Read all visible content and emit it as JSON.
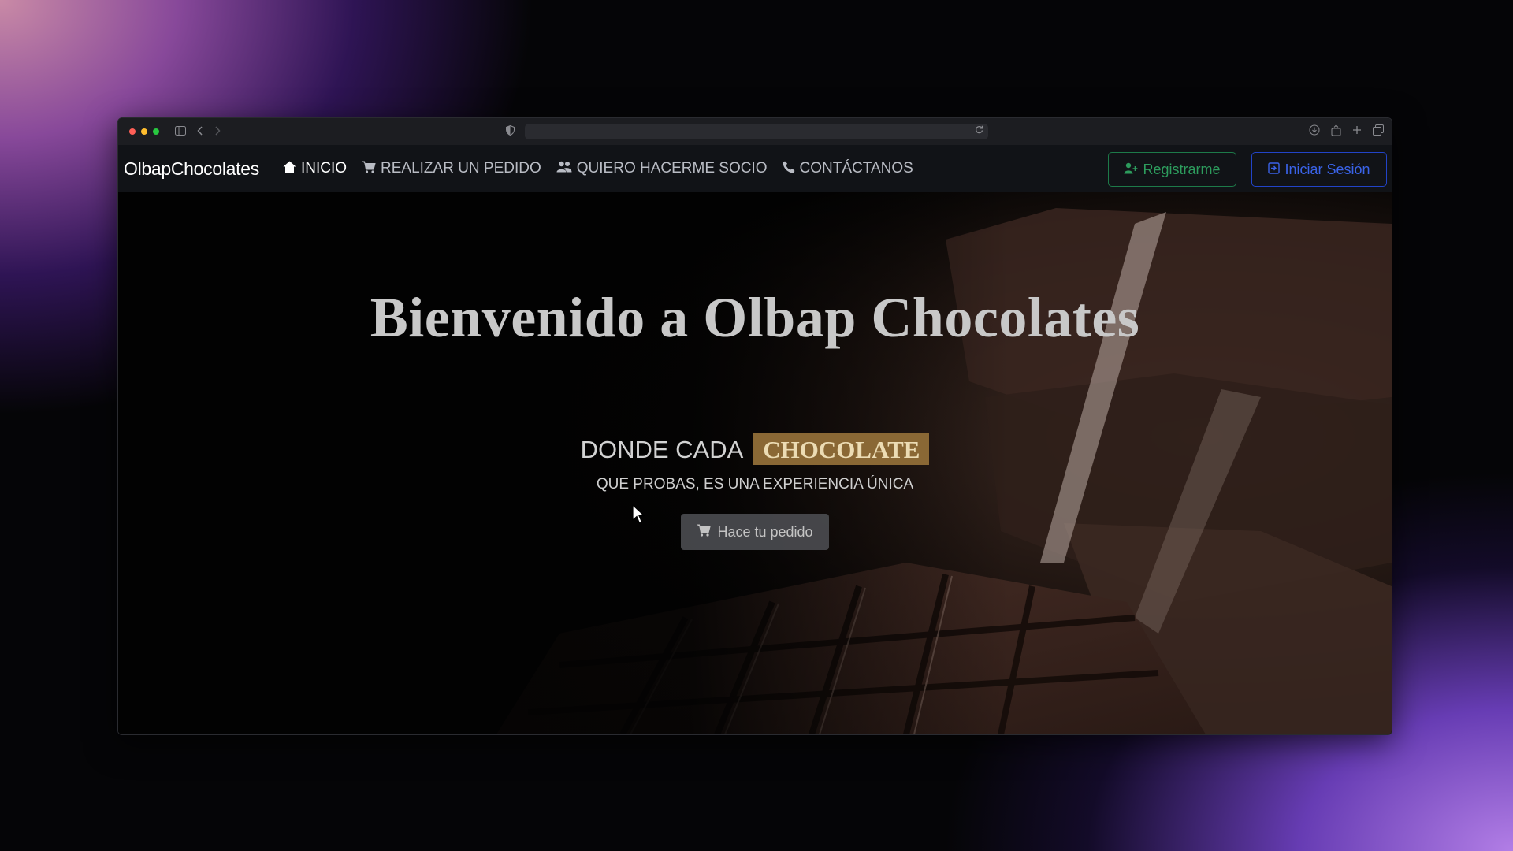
{
  "browser": {
    "icons": {
      "sidebar": "sidebar-icon",
      "back": "chevron-left-icon",
      "forward": "chevron-right-icon",
      "privacy": "shield-icon",
      "reload": "reload-icon",
      "download": "download-icon",
      "share": "share-icon",
      "new_tab": "plus-icon",
      "tabs": "tabs-overview-icon"
    }
  },
  "navbar": {
    "brand": "OlbapChocolates",
    "items": [
      {
        "label": "INICIO",
        "icon": "home-icon",
        "active": true
      },
      {
        "label": "REALIZAR UN PEDIDO",
        "icon": "cart-icon",
        "active": false
      },
      {
        "label": "QUIERO HACERME SOCIO",
        "icon": "users-icon",
        "active": false
      },
      {
        "label": "CONTÁCTANOS",
        "icon": "phone-icon",
        "active": false
      }
    ],
    "register_label": "Registrarme",
    "login_label": "Iniciar Sesión"
  },
  "hero": {
    "title": "Bienvenido a Olbap Chocolates",
    "subtitle_prefix": "DONDE CADA",
    "subtitle_highlight": "CHOCOLATE",
    "tagline": "QUE PROBAS, ES UNA EXPERIENCIA ÚNICA",
    "cta_label": "Hace tu pedido"
  },
  "colors": {
    "brand_highlight": "#8a6835",
    "register": "#2d9c5d",
    "login": "#3a63e8"
  }
}
